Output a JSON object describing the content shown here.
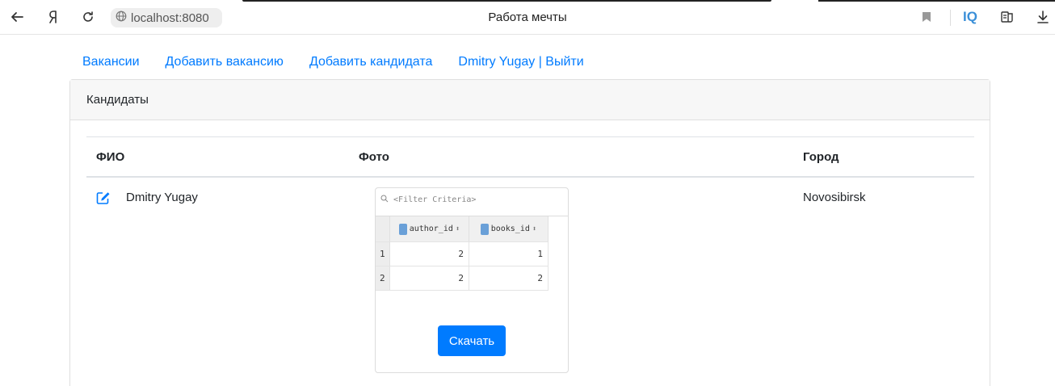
{
  "browser": {
    "url": "localhost:8080",
    "title": "Работа мечты",
    "iq_label": "IQ"
  },
  "nav": {
    "vacancies": "Вакансии",
    "add_vacancy": "Добавить вакансию",
    "add_candidate": "Добавить кандидата",
    "user_logout": "Dmitry Yugay | Выйти"
  },
  "card": {
    "header": "Кандидаты"
  },
  "table": {
    "columns": [
      "ФИО",
      "Фото",
      "Город"
    ],
    "rows": [
      {
        "name": "Dmitry Yugay",
        "city": "Novosibirsk",
        "download_label": "Скачать"
      }
    ]
  },
  "photo": {
    "filter_placeholder": "<Filter Criteria>",
    "columns": [
      "author_id",
      "books_id"
    ],
    "rows": [
      {
        "num": "1",
        "author_id": "2",
        "books_id": "1"
      },
      {
        "num": "2",
        "author_id": "2",
        "books_id": "2"
      }
    ]
  },
  "colors": {
    "link": "#007bff",
    "button": "#007bff",
    "iq": "#3a8fd8"
  },
  "icons": [
    "back-arrow-icon",
    "yandex-icon",
    "reload-icon",
    "globe-icon",
    "bookmark-icon",
    "collections-icon",
    "download-icon",
    "edit-icon"
  ]
}
